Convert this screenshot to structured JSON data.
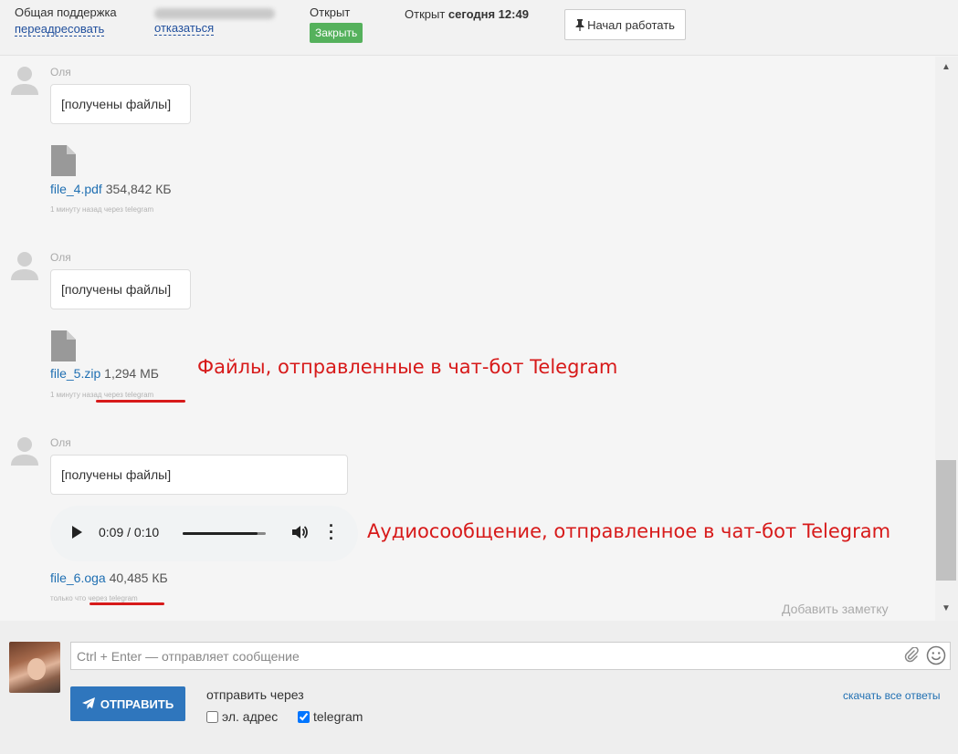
{
  "header": {
    "queue_label": "Общая поддержка",
    "forward_link": "переадресовать",
    "refuse_link": "отказаться",
    "status_label": "Открыт",
    "close_button": "Закрыть",
    "opened_prefix": "Открыт",
    "opened_time": "сегодня 12:49",
    "start_work_button": "Начал работать"
  },
  "messages": [
    {
      "author": "Оля",
      "text": "[получены файлы]",
      "file_name": "file_4.pdf",
      "file_size": "354,842 КБ",
      "meta": "1 минуту назад через telegram"
    },
    {
      "author": "Оля",
      "text": "[получены файлы]",
      "file_name": "file_5.zip",
      "file_size": "1,294 МБ",
      "meta": "1 минуту назад через telegram"
    },
    {
      "author": "Оля",
      "text": "[получены файлы]",
      "audio_time": "0:09 / 0:10",
      "audio_progress": 0.9,
      "file_name": "file_6.oga",
      "file_size": "40,485 КБ",
      "meta": "только что через telegram"
    }
  ],
  "annotations": {
    "files_note": "Файлы, отправленные в чат-бот Telegram",
    "audio_note": "Аудиосообщение, отправленное в чат-бот Telegram",
    "accent_color": "#d71a1a"
  },
  "add_note": "Добавить заметку",
  "composer": {
    "placeholder": "Ctrl + Enter — отправляет сообщение",
    "send_button": "ОТПРАВИТЬ",
    "send_via_label": "отправить через",
    "channel_email": "эл. адрес",
    "channel_email_checked": false,
    "channel_telegram": "telegram",
    "channel_telegram_checked": true,
    "download_all": "скачать все ответы"
  },
  "colors": {
    "link": "#1f6fb2",
    "close_button": "#55b15c",
    "send_button": "#2f76bd"
  }
}
